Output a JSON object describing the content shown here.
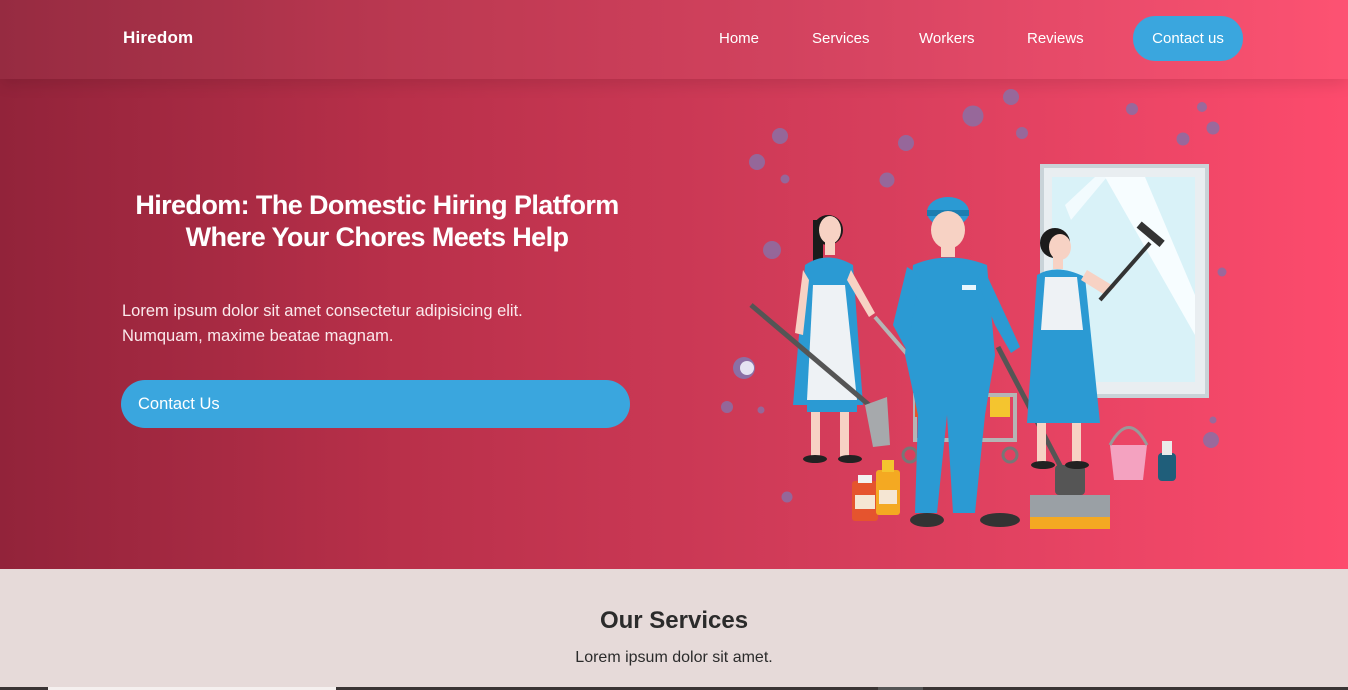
{
  "nav": {
    "brand": "Hiredom",
    "links": [
      "Home",
      "Services",
      "Workers",
      "Reviews"
    ],
    "cta": "Contact us"
  },
  "hero": {
    "title": "Hiredom: The Domestic Hiring Platform Where Your Chores Meets Help",
    "description": "Lorem ipsum dolor sit amet consectetur adipisicing elit. Numquam, maxime beatae magnam.",
    "button": "Contact Us",
    "illustration": "cleaning-workers-illustration"
  },
  "services": {
    "title": "Our Services",
    "subtitle": "Lorem ipsum dolor sit amet."
  },
  "colors": {
    "hero_gradient_start": "#92233a",
    "hero_gradient_end": "#fd4b6d",
    "accent_blue": "#3aa6de",
    "section_bg": "#e6dad9"
  }
}
